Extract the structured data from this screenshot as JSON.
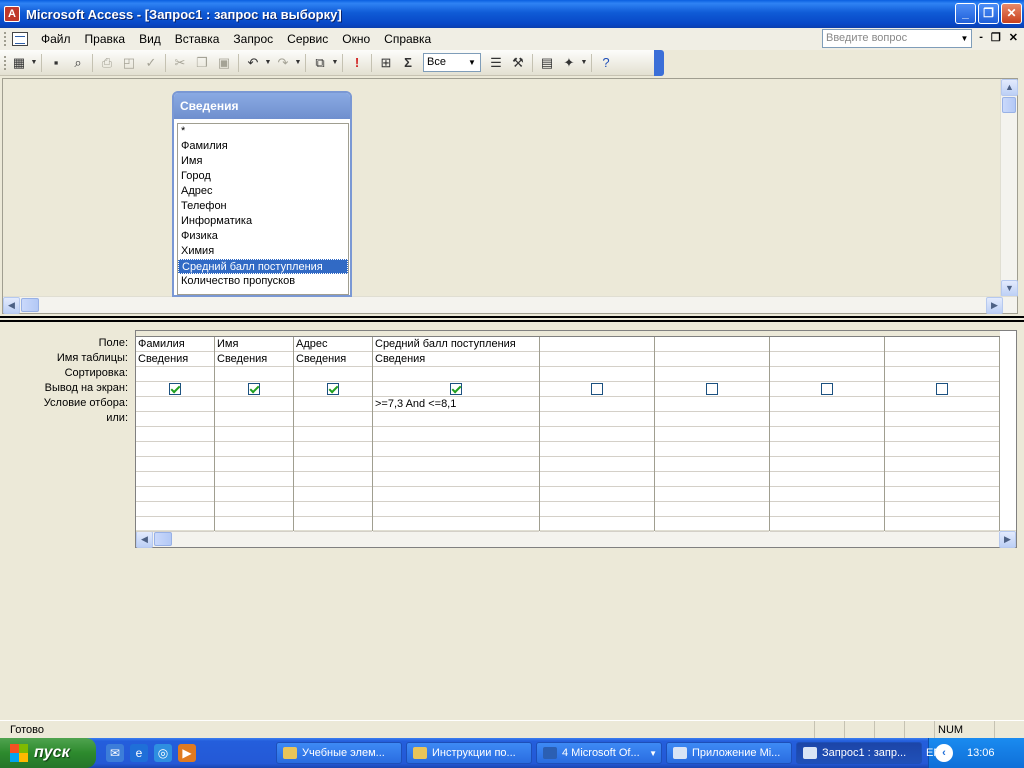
{
  "window": {
    "title": "Microsoft Access - [Запрос1 : запрос на выборку]",
    "controls": [
      "_",
      "❐",
      "✕"
    ]
  },
  "menu": {
    "items": [
      "Файл",
      "Правка",
      "Вид",
      "Вставка",
      "Запрос",
      "Сервис",
      "Окно",
      "Справка"
    ],
    "ask_placeholder": "Введите вопрос",
    "mdi_controls": [
      "-",
      "❐",
      "✕"
    ]
  },
  "toolbar": {
    "top_values": "Все"
  },
  "field_list": {
    "title": "Сведения",
    "fields": [
      "*",
      "Фамилия",
      "Имя",
      "Город",
      "Адрес",
      "Телефон",
      "Информатика",
      "Физика",
      "Химия",
      "Средний балл поступления",
      "Количество пропусков"
    ],
    "selected": "Средний балл поступления"
  },
  "qbe": {
    "row_labels": [
      "Поле:",
      "Имя таблицы:",
      "Сортировка:",
      "Вывод на экран:",
      "Условие отбора:",
      "или:"
    ],
    "columns": [
      {
        "field": "Фамилия",
        "table": "Сведения",
        "sort": "",
        "show": true,
        "criteria": ""
      },
      {
        "field": "Имя",
        "table": "Сведения",
        "sort": "",
        "show": true,
        "criteria": ""
      },
      {
        "field": "Адрес",
        "table": "Сведения",
        "sort": "",
        "show": true,
        "criteria": ""
      },
      {
        "field": "Средний балл поступления",
        "table": "Сведения",
        "sort": "",
        "show": true,
        "criteria": ">=7,3 And <=8,1"
      },
      {
        "field": "",
        "table": "",
        "sort": "",
        "show": false,
        "criteria": ""
      },
      {
        "field": "",
        "table": "",
        "sort": "",
        "show": false,
        "criteria": ""
      },
      {
        "field": "",
        "table": "",
        "sort": "",
        "show": false,
        "criteria": ""
      },
      {
        "field": "",
        "table": "",
        "sort": "",
        "show": false,
        "criteria": ""
      }
    ]
  },
  "status": {
    "text": "Готово",
    "num": "NUM"
  },
  "taskbar": {
    "start": "пуск",
    "tasks": [
      "Учебные элем...",
      "Инструкции по...",
      "4 Microsoft Of...",
      "Приложение Mi...",
      "Запрос1 : запр..."
    ],
    "active_task": 4,
    "lang": "EN",
    "clock": "13:06"
  },
  "colors": {
    "title_blue": "#0848C7",
    "selection": "#316AC5",
    "check_green": "#21A121",
    "start_green": "#2D8A2D"
  }
}
